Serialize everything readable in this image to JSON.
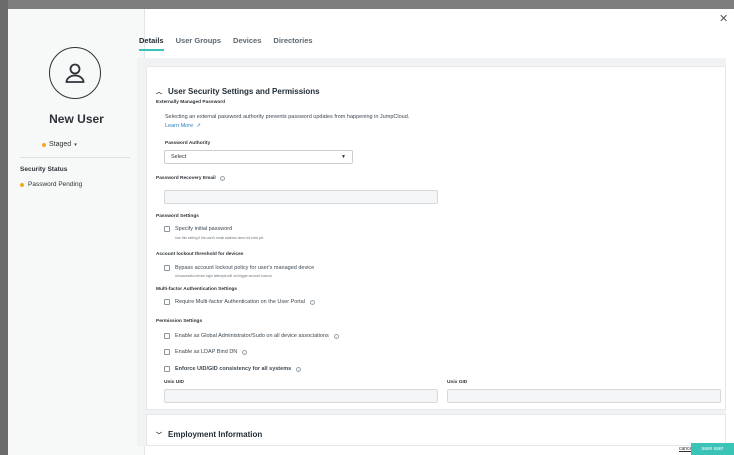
{
  "user": {
    "name": "New User",
    "state": "Staged",
    "security_status_label": "Security Status",
    "security_status_value": "Password Pending"
  },
  "tabs": [
    "Details",
    "User Groups",
    "Devices",
    "Directories"
  ],
  "section": {
    "title": "User Security Settings and Permissions",
    "externally_managed_label": "Externally Managed Password",
    "externally_managed_text": "Selecting an external password authority prevents password updates from happening in JumpCloud.",
    "learn_more": "Learn More",
    "password_authority_label": "Password Authority",
    "password_authority_value": "Select",
    "recovery_email_label": "Password Recovery Email",
    "password_settings_label": "Password Settings",
    "specify_initial_password": "Specify initial password",
    "specify_initial_password_help": "Use this setting if the user's email address does not exist yet.",
    "lockout_label": "Account lockout threshold for devices",
    "bypass_lockout": "Bypass account lockout policy for user's managed device",
    "bypass_lockout_help": "Unsuccessful device login attempts will not trigger account lockout.",
    "mfa_label": "Multi-factor Authentication Settings",
    "require_mfa": "Require Multi-factor Authentication on the User Portal",
    "permission_label": "Permission Settings",
    "global_admin": "Enable as Global Administrator/Sudo on all device associations",
    "ldap_bind": "Enable as LDAP Bind DN",
    "uid_gid": "Enforce UID/GID consistency for all systems",
    "unix_uid_label": "Unix UID",
    "unix_gid_label": "Unix GID"
  },
  "employment": {
    "title": "Employment Information"
  },
  "footer": {
    "cancel": "cancel",
    "save": "save user"
  },
  "icons": {
    "close": "close-icon",
    "chevron_up": "chevron-up-icon",
    "chevron_down": "chevron-down-icon",
    "user": "user-icon",
    "info": "info-icon",
    "external_link": "external-link-icon"
  },
  "colors": {
    "accent": "#3ac4b8",
    "status_dot": "#f5a623",
    "link": "#2a82c4"
  }
}
